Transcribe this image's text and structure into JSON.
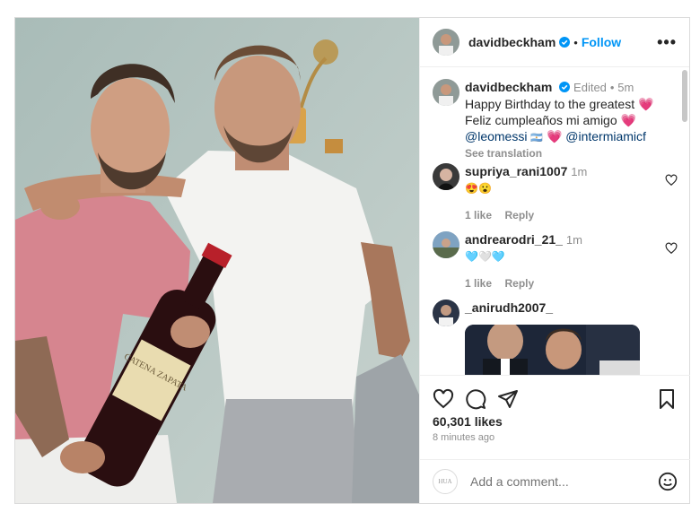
{
  "post": {
    "author": "davidbeckham",
    "follow_label": "Follow",
    "dot": "•",
    "more_label": "•••"
  },
  "caption": {
    "author": "davidbeckham",
    "edited": "Edited",
    "dot": "•",
    "time": "5m",
    "line1": "Happy Birthday to the greatest 💗",
    "line2": "Feliz cumpleaños mi amigo 💗",
    "mention1": "@leomessi",
    "flag": "🇦🇷",
    "heart": "💗",
    "mention2": "@intermiamicf",
    "see_translation": "See translation"
  },
  "comments": [
    {
      "user": "supriya_rani1007",
      "time": "1m",
      "text": "😍😮",
      "likes": "1 like",
      "reply": "Reply"
    },
    {
      "user": "andrearodri_21_",
      "time": "1m",
      "text": "🩵🤍🩵",
      "likes": "1 like",
      "reply": "Reply"
    },
    {
      "user": "_anirudh2007_"
    }
  ],
  "footer": {
    "likes": "60,301 likes",
    "ago": "8 minutes ago",
    "add_comment_placeholder": "Add a comment...",
    "avatar_text": "HUA"
  },
  "colors": {
    "link": "#00376b",
    "follow": "#0095f6",
    "muted": "#8e8e8e",
    "verified": "#0095f6"
  },
  "icons": [
    "more-icon",
    "verified-icon",
    "heart-icon",
    "comment-icon",
    "share-icon",
    "bookmark-icon",
    "emoji-icon"
  ]
}
